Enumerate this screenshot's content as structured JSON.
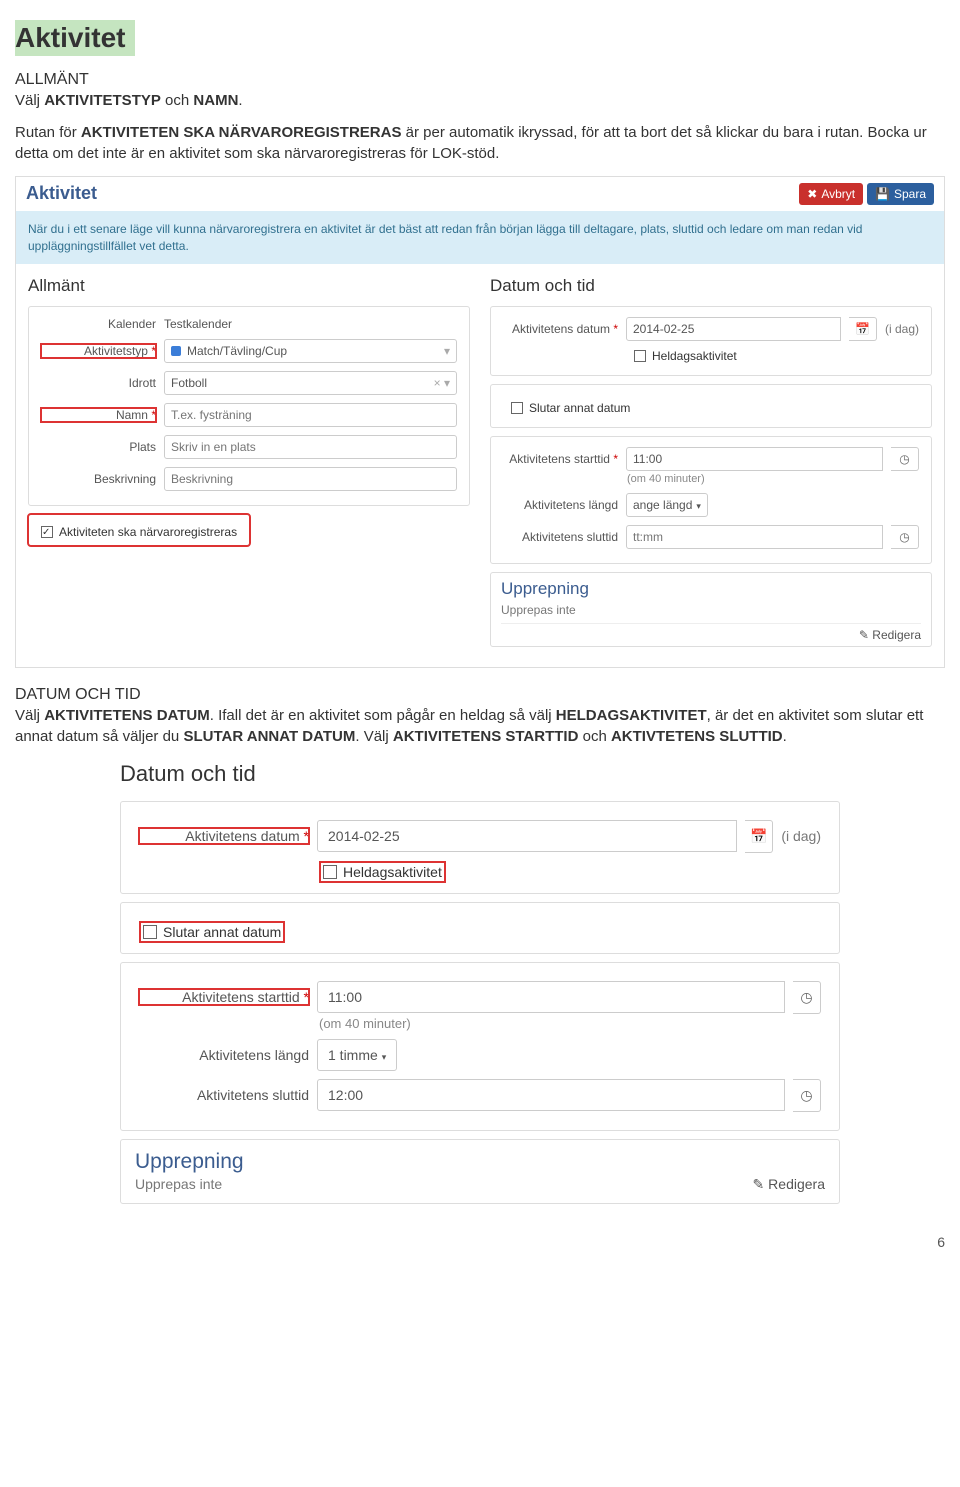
{
  "heading": "Aktivitet",
  "intro": {
    "allmant": "ALLMÄNT",
    "line1_pre": "Välj ",
    "line1_b1": "AKTIVITETSTYP",
    "line1_mid": " och ",
    "line1_b2": "NAMN",
    "line1_end": ".",
    "para2_pre": "Rutan för ",
    "para2_b": "AKTIVITETEN SKA NÄRVAROREGISTRERAS",
    "para2_post": " är per automatik ikryssad, för att ta bort det så klickar du bara i rutan. Bocka ur detta om det inte är en aktivitet som ska närvaroregistreras för LOK-stöd."
  },
  "panel1": {
    "title": "Aktivitet",
    "btn_cancel": "Avbryt",
    "btn_save": "Spara",
    "info": "När du i ett senare läge vill kunna närvaroregistrera en aktivitet är det bäst att redan från början lägga till deltagare, plats, sluttid och ledare om man redan vid uppläggningstillfället vet detta.",
    "left": {
      "h": "Allmänt",
      "kalender_l": "Kalender",
      "kalender_v": "Testkalender",
      "akttyp_l": "Aktivitetstyp",
      "akttyp_v": "Match/Tävling/Cup",
      "idrott_l": "Idrott",
      "idrott_v": "Fotboll",
      "namn_l": "Namn",
      "namn_ph": "T.ex. fysträning",
      "plats_l": "Plats",
      "plats_ph": "Skriv in en plats",
      "beskr_l": "Beskrivning",
      "beskr_ph": "Beskrivning",
      "chk_label": "Aktiviteten ska närvaroregistreras"
    },
    "right": {
      "h": "Datum och tid",
      "datum_l": "Aktivitetens datum",
      "datum_v": "2014-02-25",
      "idag": "(i dag)",
      "heldag": "Heldagsaktivitet",
      "slutar": "Slutar annat datum",
      "start_l": "Aktivitetens starttid",
      "start_v": "11:00",
      "start_note": "(om 40 minuter)",
      "langd_l": "Aktivitetens längd",
      "langd_v": "ange längd",
      "slut_l": "Aktivitetens sluttid",
      "slut_ph": "tt:mm",
      "upprep_title": "Upprepning",
      "upprep_sub": "Upprepas inte",
      "redigera": "Redigera"
    }
  },
  "mid": {
    "h": "DATUM OCH TID",
    "p_pre": "Välj ",
    "p_b1": "AKTIVITETENS DATUM",
    "p_mid1": ". Ifall det är en aktivitet som pågår en heldag så välj ",
    "p_b2": "HELDAGSAKTIVITET",
    "p_mid2": ", är det en aktivitet som slutar ett annat datum så väljer du ",
    "p_b3": "SLUTAR ANNAT DATUM",
    "p_mid3": ". Välj ",
    "p_b4": "AKTIVITETENS STARTTID",
    "p_mid4": " och ",
    "p_b5": "AKTIVTETENS SLUTTID",
    "p_end": "."
  },
  "panel2": {
    "h": "Datum och tid",
    "datum_l": "Aktivitetens datum",
    "datum_v": "2014-02-25",
    "idag": "(i dag)",
    "heldag": "Heldagsaktivitet",
    "slutar": "Slutar annat datum",
    "start_l": "Aktivitetens starttid",
    "start_v": "11:00",
    "start_note": "(om 40 minuter)",
    "langd_l": "Aktivitetens längd",
    "langd_v": "1 timme",
    "slut_l": "Aktivitetens sluttid",
    "slut_v": "12:00",
    "upprep_title": "Upprepning",
    "upprep_sub": "Upprepas inte",
    "redigera": "Redigera"
  },
  "page_num": "6"
}
